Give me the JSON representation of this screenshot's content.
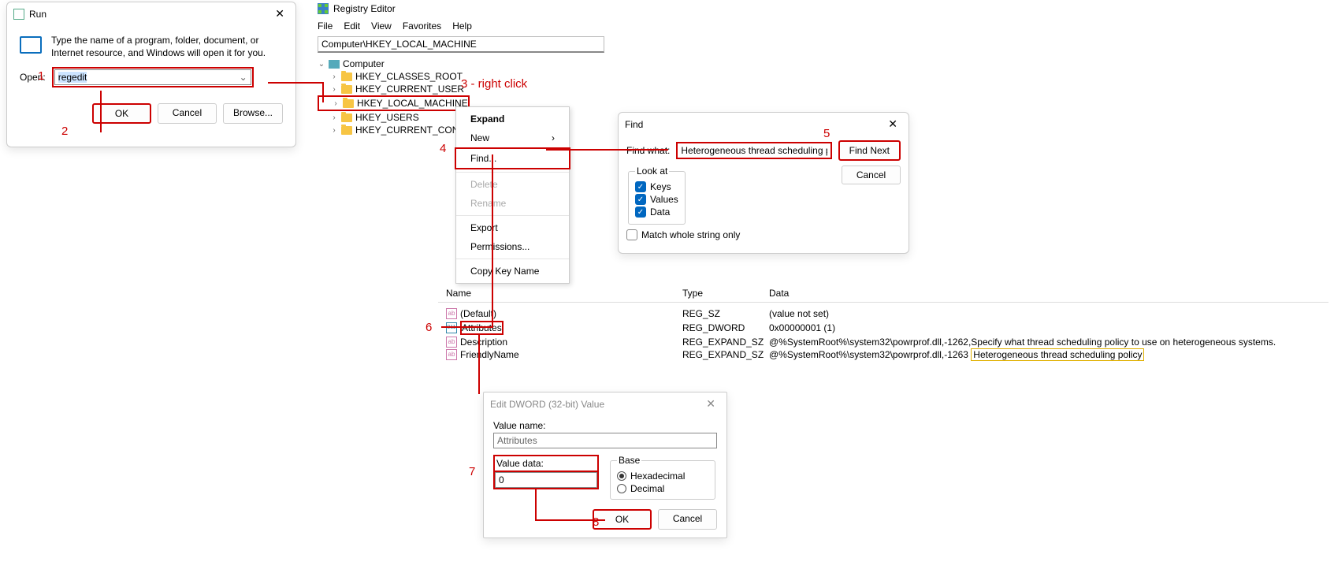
{
  "run": {
    "title": "Run",
    "desc": "Type the name of a program, folder, document, or Internet resource, and Windows will open it for you.",
    "open_label": "Open:",
    "open_value": "regedit",
    "ok": "OK",
    "cancel": "Cancel",
    "browse": "Browse..."
  },
  "regedit": {
    "title": "Registry Editor",
    "menu": {
      "file": "File",
      "edit": "Edit",
      "view": "View",
      "favorites": "Favorites",
      "help": "Help"
    },
    "path": "Computer\\HKEY_LOCAL_MACHINE",
    "tree": {
      "root": "Computer",
      "hkcr": "HKEY_CLASSES_ROOT",
      "hkcu": "HKEY_CURRENT_USER",
      "hklm": "HKEY_LOCAL_MACHINE",
      "hku": "HKEY_USERS",
      "hkcc": "HKEY_CURRENT_CON"
    }
  },
  "ctx": {
    "expand": "Expand",
    "new": "New",
    "find": "Find...",
    "delete": "Delete",
    "rename": "Rename",
    "export": "Export",
    "permissions": "Permissions...",
    "copykey": "Copy Key Name"
  },
  "find": {
    "title": "Find",
    "what_label": "Find what:",
    "what_value": "Heterogeneous thread scheduling policy",
    "next": "Find Next",
    "cancel": "Cancel",
    "lookat": "Look at",
    "keys": "Keys",
    "values": "Values",
    "data": "Data",
    "whole": "Match whole string only"
  },
  "values": {
    "col_name": "Name",
    "col_type": "Type",
    "col_data": "Data",
    "rows": [
      {
        "name": "(Default)",
        "type": "REG_SZ",
        "data": "(value not set)"
      },
      {
        "name": "Attributes",
        "type": "REG_DWORD",
        "data": "0x00000001 (1)"
      },
      {
        "name": "Description",
        "type": "REG_EXPAND_SZ",
        "data_prefix": "@%SystemRoot%\\system32\\powrprof.dll,-1262,Specify what thread scheduling policy to use on heterogeneous systems."
      },
      {
        "name": "FriendlyName",
        "type": "REG_EXPAND_SZ",
        "data_prefix": "@%SystemRoot%\\system32\\powrprof.dll,-1263",
        "data_hl": "Heterogeneous thread scheduling policy"
      }
    ]
  },
  "dword": {
    "title": "Edit DWORD (32-bit) Value",
    "vname_label": "Value name:",
    "vname": "Attributes",
    "vdata_label": "Value data:",
    "vdata": "0",
    "base": "Base",
    "hex": "Hexadecimal",
    "dec": "Decimal",
    "ok": "OK",
    "cancel": "Cancel"
  },
  "anno": {
    "s1": "1",
    "s2": "2",
    "s3": "3 - right click",
    "s4": "4",
    "s5": "5",
    "s6": "6",
    "s7": "7",
    "s8": "8"
  }
}
